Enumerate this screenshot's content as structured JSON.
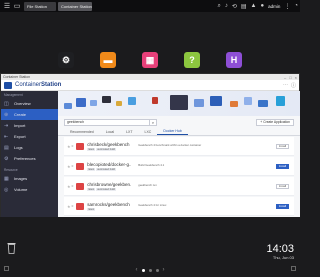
{
  "system_bar": {
    "tabs": [
      {
        "label": "File Station"
      },
      {
        "label": "Container Station"
      }
    ],
    "user": "admin"
  },
  "desktop_apps": [
    {
      "icon": "gear-icon",
      "color": "#1e1f22"
    },
    {
      "icon": "folder-icon",
      "color": "#f08a1a"
    },
    {
      "icon": "app-center-icon",
      "color": "#e8407a"
    },
    {
      "icon": "help-icon",
      "color": "#8cc63f"
    },
    {
      "icon": "hd-icon",
      "color": "#8e4fd6"
    }
  ],
  "window": {
    "title": "Container Station",
    "app_name_light": "Container",
    "app_name_bold": "Station"
  },
  "sidebar": {
    "section1": "Management",
    "items": [
      {
        "label": "Overview",
        "icon": "overview-icon"
      },
      {
        "label": "Create",
        "icon": "create-icon"
      },
      {
        "label": "Import",
        "icon": "import-icon"
      },
      {
        "label": "Export",
        "icon": "export-icon"
      },
      {
        "label": "Logs",
        "icon": "logs-icon"
      },
      {
        "label": "Preferences",
        "icon": "preferences-icon"
      }
    ],
    "section2": "Resource",
    "items2": [
      {
        "label": "Images",
        "icon": "images-icon"
      },
      {
        "label": "Volume",
        "icon": "volume-icon"
      }
    ],
    "active_index": 1
  },
  "search": {
    "value": "geekbench"
  },
  "create_app_button": "Create Application",
  "tabs": [
    {
      "label": "Recommended"
    },
    {
      "label": "Local"
    },
    {
      "label": "LXT"
    },
    {
      "label": "LXC"
    },
    {
      "label": "Docker Hub"
    }
  ],
  "results": [
    {
      "name": "chrisbeck/geekbench",
      "stars": "0",
      "tags": [
        "latest",
        "automated build"
      ],
      "desc": "Geekbench 4 benchmark within a docker container",
      "install": "Install",
      "primary": false
    },
    {
      "name": "blecopioted/docker-g...",
      "stars": "0",
      "tags": [
        "latest",
        "automated build"
      ],
      "desc": "Build Geekbench 4.1",
      "install": "Install",
      "primary": true
    },
    {
      "name": "chrisbrowne/geekben...",
      "stars": "0",
      "tags": [
        "latest",
        "automated build"
      ],
      "desc": "geekbench run",
      "install": "Install",
      "primary": false
    },
    {
      "name": "samrocks/geekbench",
      "stars": "0",
      "tags": [
        "latest"
      ],
      "desc": "Geekbench 4 for Linux",
      "install": "Install",
      "primary": true
    }
  ],
  "clock": {
    "time": "14:03",
    "date": "Thu, Jun 03"
  }
}
